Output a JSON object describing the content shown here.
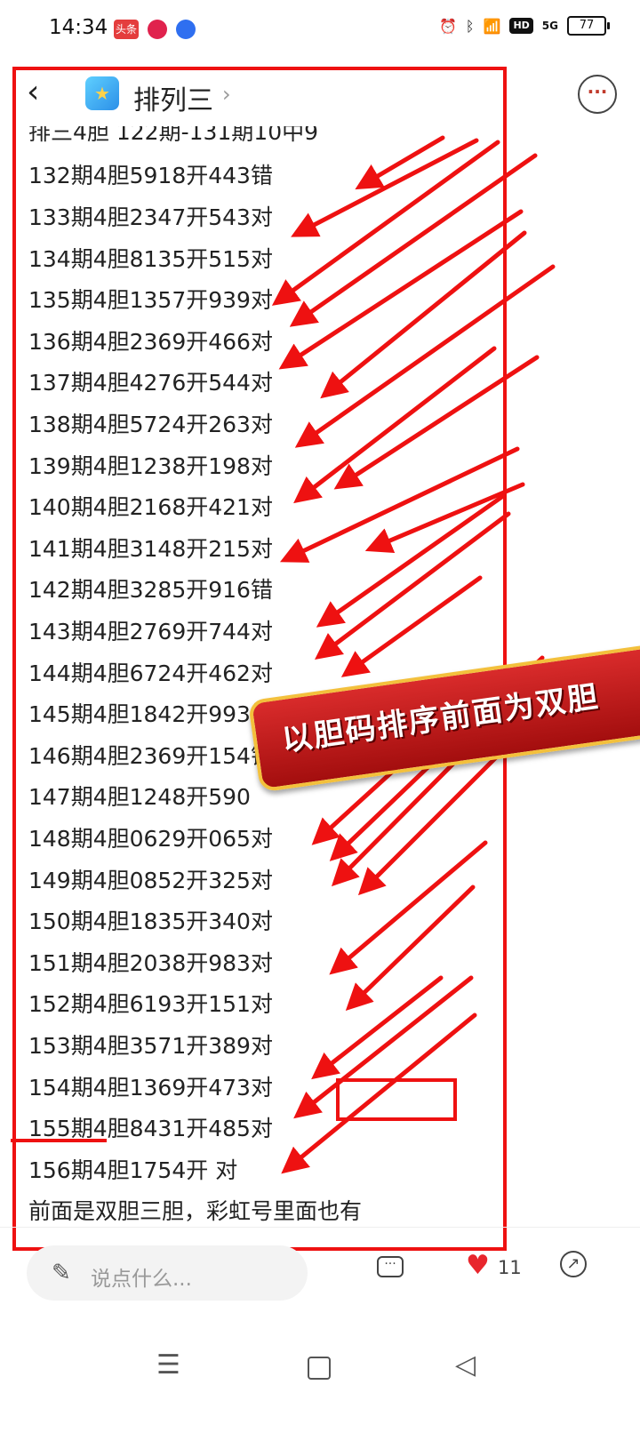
{
  "status_bar": {
    "time": "14:34",
    "badges": [
      "头条",
      "",
      ""
    ],
    "right": {
      "hd": "HD",
      "net": "5G",
      "battery": "77"
    }
  },
  "nav": {
    "back_icon": "‹",
    "title": "排列三",
    "chevron": "›",
    "more_icon": "···"
  },
  "post": {
    "lines": [
      "排三4胆 122期-131期10中9",
      "132期4胆5918开443错",
      "133期4胆2347开543对",
      "134期4胆8135开515对",
      "135期4胆1357开939对",
      "136期4胆2369开466对",
      "137期4胆4276开544对",
      "138期4胆5724开263对",
      "139期4胆1238开198对",
      "140期4胆2168开421对",
      "141期4胆3148开215对",
      "142期4胆3285开916错",
      "143期4胆2769开744对",
      "144期4胆6724开462对",
      "145期4胆1842开993错",
      "146期4胆2369开154错",
      "147期4胆1248开590",
      "148期4胆0629开065对",
      "149期4胆0852开325对",
      "150期4胆1835开340对",
      "151期4胆2038开983对",
      "152期4胆6193开151对",
      "153期4胆3571开389对",
      "154期4胆1369开473对",
      "155期4胆8431开485对",
      "156期4胆1754开 对",
      "前面是双胆三胆，彩虹号里面也有"
    ],
    "banner": "以胆码排序前面为双胆"
  },
  "bottom_bar": {
    "comment_placeholder": "说点什么...",
    "like_count": "11"
  },
  "colors": {
    "annotation_red": "#ee1111",
    "like_red": "#e8262d"
  }
}
